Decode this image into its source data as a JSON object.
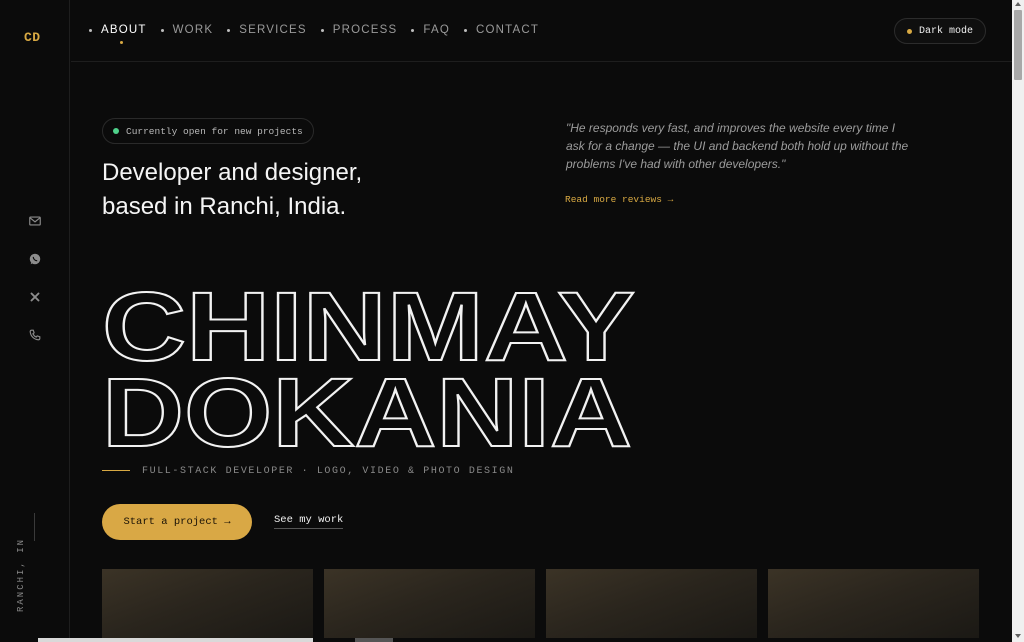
{
  "brand": {
    "logo": "CD",
    "accent": "#d8a943"
  },
  "nav": {
    "items": [
      {
        "label": "ABOUT",
        "active": true
      },
      {
        "label": "WORK",
        "active": false
      },
      {
        "label": "SERVICES",
        "active": false
      },
      {
        "label": "PROCESS",
        "active": false
      },
      {
        "label": "FAQ",
        "active": false
      },
      {
        "label": "CONTACT",
        "active": false
      }
    ],
    "mode_label": "Dark mode"
  },
  "rail": {
    "icons": [
      "mail-icon",
      "whatsapp-icon",
      "x-icon",
      "phone-icon"
    ],
    "location": "RANCHI, IN"
  },
  "hero": {
    "badge": "Currently open for new projects",
    "headline_line1": "Developer and designer,",
    "headline_line2": "based in Ranchi, India.",
    "quote": "\"He responds very fast, and improves the website every time I ask for a change — the UI and backend both hold up without the problems I've had with other developers.\"",
    "reviews_link": "Read more reviews →",
    "name_line1": "CHINMAY",
    "name_line2": "DOKANIA",
    "role": "FULL-STACK DEVELOPER · LOGO, VIDEO & PHOTO DESIGN",
    "cta_primary": "Start a project →",
    "cta_secondary": "See my work"
  }
}
